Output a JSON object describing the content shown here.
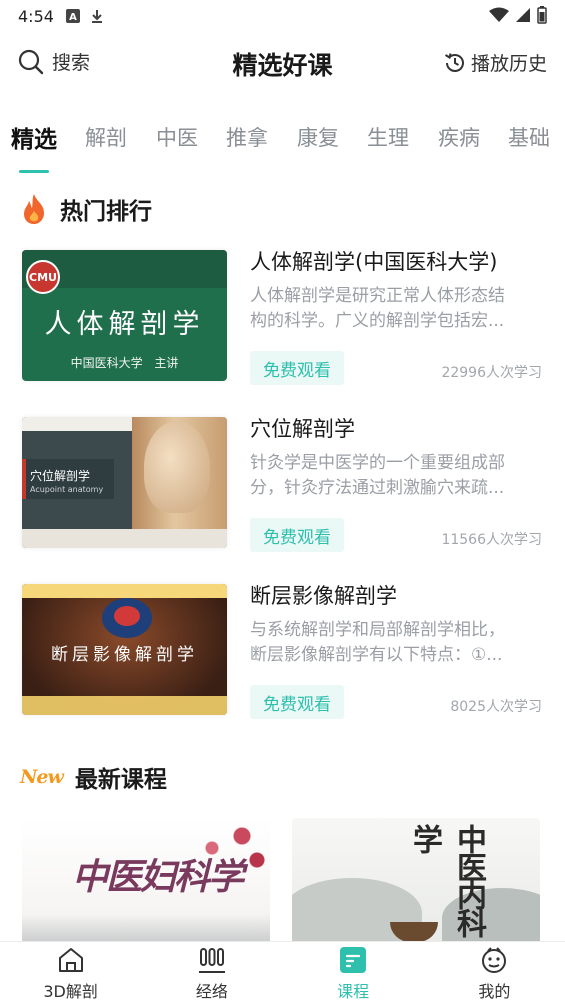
{
  "status": {
    "time": "4:54"
  },
  "header": {
    "search_label": "搜索",
    "title": "精选好课",
    "history_label": "播放历史"
  },
  "tabs": [
    {
      "label": "精选",
      "active": true
    },
    {
      "label": "解剖"
    },
    {
      "label": "中医"
    },
    {
      "label": "推拿"
    },
    {
      "label": "康复"
    },
    {
      "label": "生理"
    },
    {
      "label": "疾病"
    },
    {
      "label": "基础"
    }
  ],
  "hot": {
    "title": "热门排行",
    "courses": [
      {
        "title": "人体解剖学(中国医科大学)",
        "desc1": "人体解剖学是研究正常人体形态结",
        "desc2": "构的科学。广义的解剖学包括宏...",
        "button": "免费观看",
        "count": "22996人次学习",
        "thumb_big": "人体解剖学",
        "thumb_small": "中国医科大学  主讲"
      },
      {
        "title": "穴位解剖学",
        "desc1": "针灸学是中医学的一个重要组成部",
        "desc2": "分，针灸疗法通过刺激腧穴来疏...",
        "button": "免费观看",
        "count": "11566人次学习",
        "thumb_big": "穴位解剖学",
        "thumb_small": "Acupoint anatomy"
      },
      {
        "title": "断层影像解剖学",
        "desc1": "与系统解剖学和局部解剖学相比，",
        "desc2": "断层影像解剖学有以下特点：①...",
        "button": "免费观看",
        "count": "8025人次学习",
        "thumb_big": "断层影像解剖学"
      }
    ]
  },
  "latest": {
    "badge": "New",
    "title": "最新课程",
    "cards": [
      {
        "thumb_text": "中医妇科学"
      },
      {
        "thumb_text": "中医内科学"
      }
    ]
  },
  "bottom_nav": [
    {
      "label": "3D解剖",
      "icon": "home-icon"
    },
    {
      "label": "经络",
      "icon": "meridian-icon"
    },
    {
      "label": "课程",
      "icon": "course-icon",
      "active": true
    },
    {
      "label": "我的",
      "icon": "profile-icon"
    }
  ],
  "colors": {
    "accent": "#2fbfad",
    "free_bg": "#eaf8f6",
    "flame": "#f0662b",
    "new_badge": "#f29a1e"
  }
}
